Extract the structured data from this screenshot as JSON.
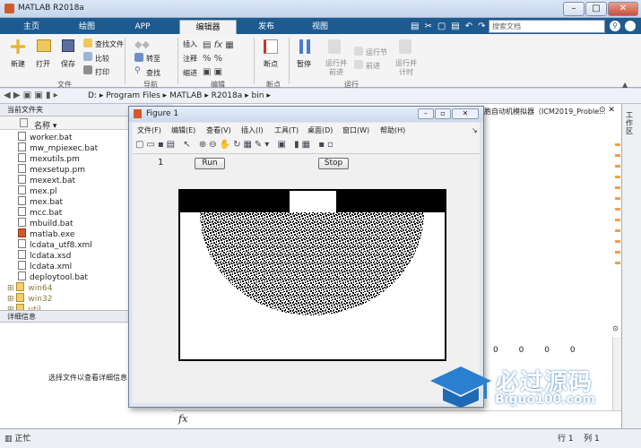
{
  "window": {
    "title": "MATLAB R2018a"
  },
  "tabs": [
    "主页",
    "绘图",
    "APP",
    "编辑器",
    "发布",
    "视图"
  ],
  "active_tab": "编辑器",
  "search": {
    "placeholder": "搜索文档"
  },
  "ribbon": {
    "new": "新建",
    "open": "打开",
    "save": "保存",
    "find_files": "查找文件",
    "compare": "比较",
    "print": "打印",
    "insert": "插入",
    "comment": "注释",
    "indent": "缩进",
    "goto": "转至",
    "find": "查找",
    "breakpoints": "断点",
    "pause": "暂停",
    "run_advance": "运行并\n前进",
    "run_section": "运行节",
    "advance": "前进",
    "run_time": "运行并\n计时",
    "sections": {
      "file": "文件",
      "navigate": "导航",
      "edit": "编辑",
      "breakpoints": "断点",
      "run": "运行"
    }
  },
  "address": [
    "D:",
    "Program Files",
    "MATLAB",
    "R2018a",
    "bin"
  ],
  "current_folder": {
    "title": "当前文件夹",
    "column": "名称",
    "files": [
      {
        "name": "worker.bat",
        "type": "file"
      },
      {
        "name": "mw_mpiexec.bat",
        "type": "file"
      },
      {
        "name": "mexutils.pm",
        "type": "file"
      },
      {
        "name": "mexsetup.pm",
        "type": "file"
      },
      {
        "name": "mexext.bat",
        "type": "file"
      },
      {
        "name": "mex.pl",
        "type": "file"
      },
      {
        "name": "mex.bat",
        "type": "file"
      },
      {
        "name": "mcc.bat",
        "type": "file"
      },
      {
        "name": "mbuild.bat",
        "type": "file"
      },
      {
        "name": "matlab.exe",
        "type": "file"
      },
      {
        "name": "lcdata_utf8.xml",
        "type": "file"
      },
      {
        "name": "lcdata.xsd",
        "type": "file"
      },
      {
        "name": "lcdata.xml",
        "type": "file"
      },
      {
        "name": "deploytool.bat",
        "type": "file"
      },
      {
        "name": "win64",
        "type": "folder"
      },
      {
        "name": "win32",
        "type": "folder"
      },
      {
        "name": "util",
        "type": "folder"
      }
    ]
  },
  "details": {
    "title": "详细信息",
    "message": "选择文件以查看详细信息"
  },
  "editor_tab": "胞自动机模拟器（ICM2019_Proble...",
  "right_strip_label": "工作区",
  "workspace_values": [
    "0",
    "0",
    "0",
    "0"
  ],
  "command_prompt": "fx",
  "status": {
    "text": "正忙",
    "row_label": "行",
    "row": "1",
    "col_label": "列",
    "col": "1"
  },
  "figure": {
    "title": "Figure 1",
    "menus": [
      "文件(F)",
      "编辑(E)",
      "查看(V)",
      "插入(I)",
      "工具(T)",
      "桌面(D)",
      "窗口(W)",
      "帮助(H)"
    ],
    "counter": "1",
    "run_label": "Run",
    "stop_label": "Stop"
  },
  "watermark": {
    "text": "必过源码",
    "sub": "Biguo100.com"
  }
}
